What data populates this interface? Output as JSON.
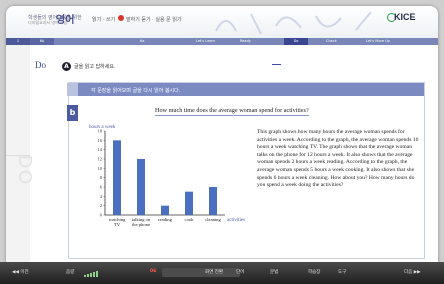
{
  "header": {
    "course_title": "학생들의 영어교육을 위한",
    "course_subtitle": "디지털교과서 영어 학습",
    "subject": "영어",
    "lesson": "읽기 · 쓰기",
    "lesson_sub": "말하기 듣기 · 실용 문 읽기",
    "logo": "KICE"
  },
  "nav": {
    "tabs": [
      "1",
      "6A",
      "6a",
      "Let's Learn",
      "Ready",
      "Do",
      "Check",
      "Let's More Up"
    ]
  },
  "strip": {
    "watermark": "DO"
  },
  "activity": {
    "section": "Do",
    "badge_a": "A",
    "instruction_a": "글을 읽고 답하세요.",
    "badge_b": "b",
    "instruction_b": "각 문장을 읽어보며 글을 다시 읽어 봅시다.",
    "question": "How much time does the average woman spend for activities?",
    "paragraph": "This graph shows how many hours the average woman spends for activities a week. According to the graph, the average woman spends 16 hours a week watching TV. The graph shows that the average woman talks on the phone for 12 hours a week. It also shows that the average woman spends 2 hours a week reading. According to the graph, the average woman spends 5 hours a week cooking. It also shows that she spends 6 hours a week cleaning. How about you? How many hours do you spend a week doing the activities?"
  },
  "chart_data": {
    "type": "bar",
    "categories": [
      "watching TV",
      "talking on the phone",
      "reading",
      "cook",
      "cleaning"
    ],
    "values": [
      16,
      12,
      2,
      5,
      6
    ],
    "ylabel": "hours a week",
    "xlabel": "activities",
    "yticks": [
      0,
      2,
      4,
      6,
      8,
      10,
      12,
      14,
      16,
      18
    ],
    "ylim": [
      0,
      18
    ],
    "bar_color": "#4a6fc0",
    "grid": false
  },
  "footer": {
    "prev": "◀◀ 이전",
    "volume": "음량",
    "page": "06",
    "tools": [
      "화면 전환",
      "단어",
      "문법",
      "학습장",
      "도구"
    ],
    "next": "다음 ▶▶"
  },
  "colors": {
    "nav_bar": "#7a86b8",
    "instruction_bar": "#7b8bc2",
    "accent": "#3c4a8c"
  }
}
